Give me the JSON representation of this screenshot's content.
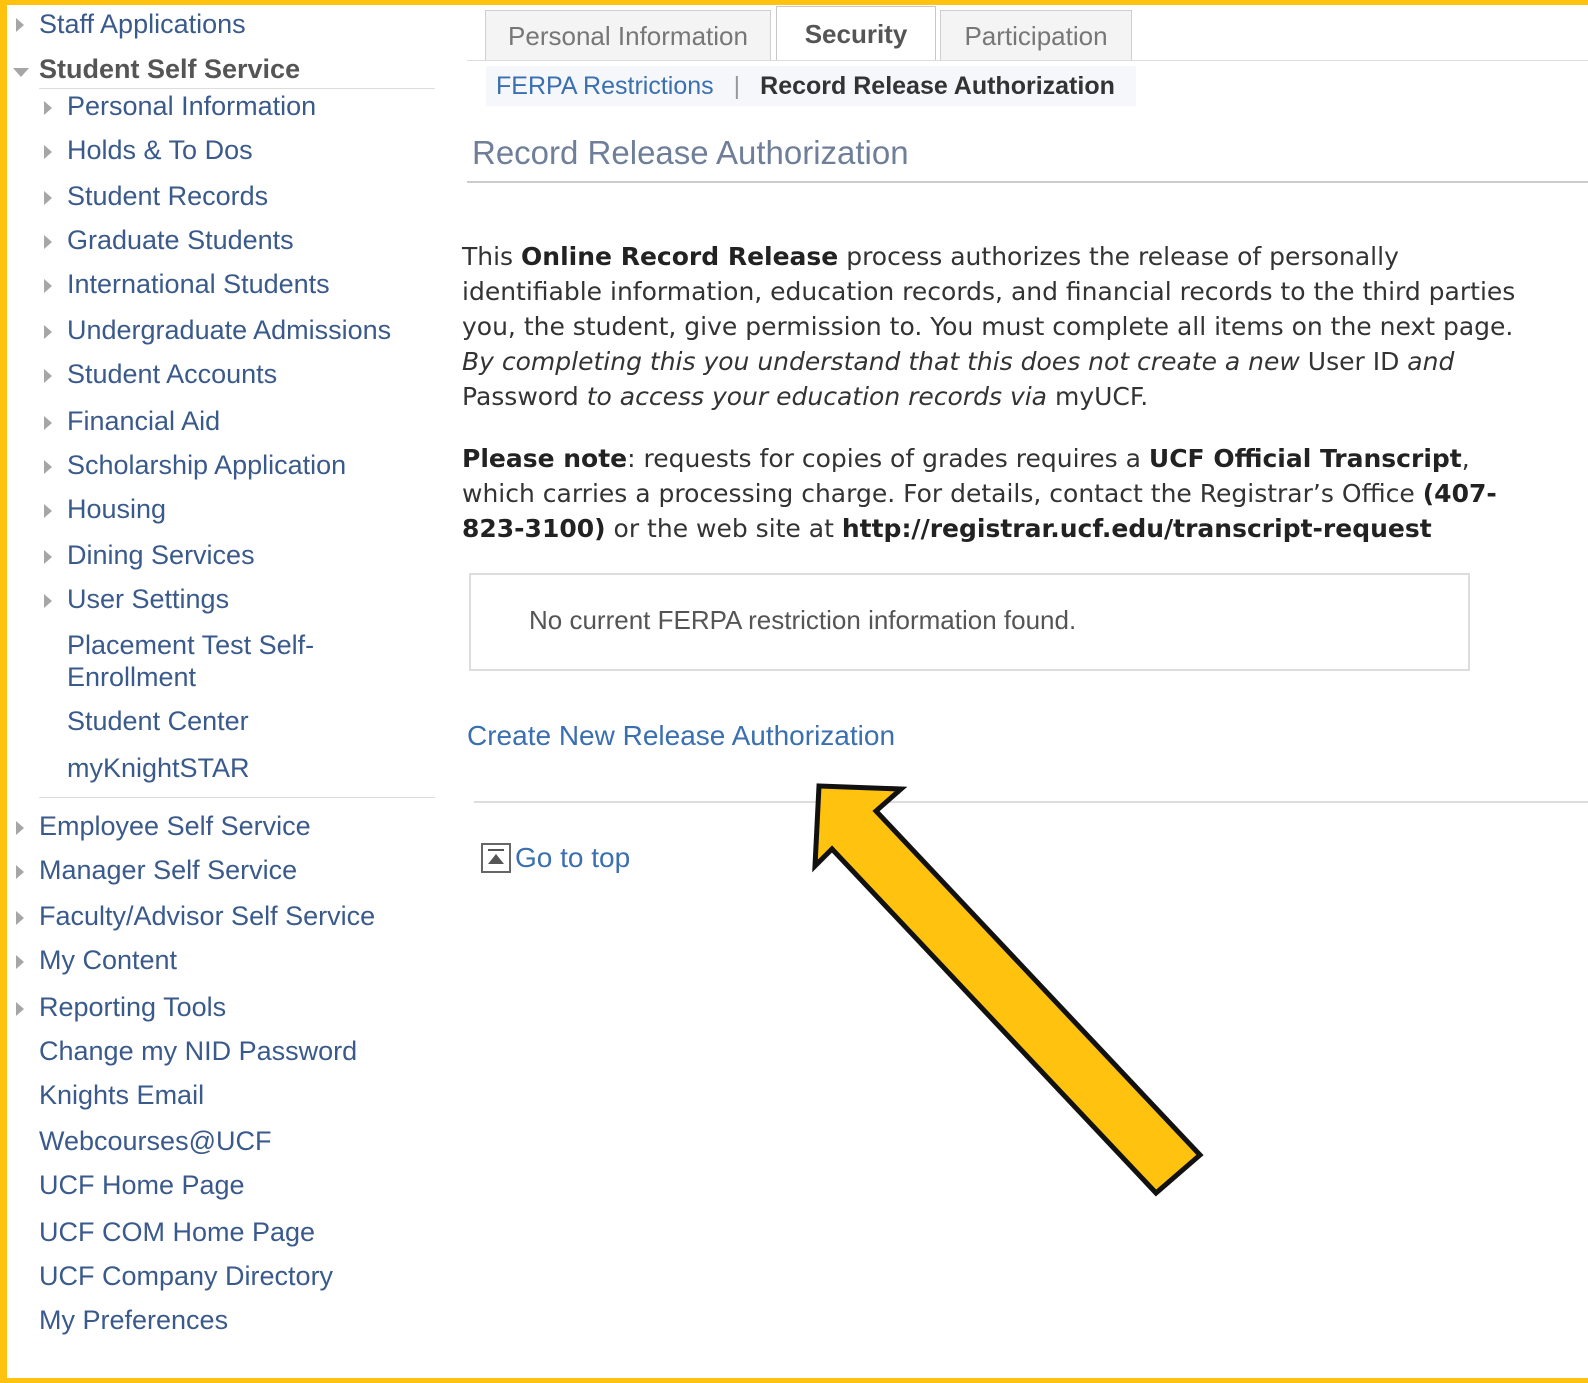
{
  "menu": {
    "staff_applications": "Staff Applications",
    "student_self_service": "Student Self Service",
    "sub_items": [
      "Personal Information",
      "Holds & To Dos",
      "Student Records",
      "Graduate Students",
      "International Students",
      "Undergraduate Admissions",
      "Student Accounts",
      "Financial Aid",
      "Scholarship Application",
      "Housing",
      "Dining Services",
      "User Settings"
    ],
    "placement_line1": "Placement Test Self-",
    "placement_line2": "Enrollment",
    "student_center": "Student Center",
    "myknightstar": "myKnightSTAR",
    "lower_items": [
      "Employee Self Service",
      "Manager Self Service",
      "Faculty/Advisor Self Service",
      "My Content",
      "Reporting Tools"
    ],
    "links": [
      "Change my NID Password",
      "Knights Email",
      "Webcourses@UCF",
      "UCF Home Page",
      "UCF COM Home Page",
      "UCF Company Directory",
      "My Preferences"
    ]
  },
  "tabs": {
    "personal": "Personal Information",
    "security": "Security",
    "participation": "Participation"
  },
  "subnav": {
    "ferpa": "FERPA Restrictions",
    "separator": "|",
    "current": "Record Release Authorization"
  },
  "page": {
    "title": "Record Release Authorization",
    "p1_a": "This ",
    "p1_b": "Online Record Release",
    "p1_c": " process authorizes the release of personally identifiable information, education records, and financial records to the third parties you, the student, give permission to. You must complete all items on the next page. ",
    "p1_d": "By completing this you understand that this does not create a new",
    "p1_e": " User ID ",
    "p1_f": "and",
    "p1_g": " Password ",
    "p1_h": "to access your education records via",
    "p1_i": " myUCF.",
    "p2_a": "Please note",
    "p2_b": ": requests for copies of grades requires a ",
    "p2_c": "UCF Official Transcript",
    "p2_d": ", which carries a processing charge. For details, contact the Registrar’s Office ",
    "p2_e": "(407-823-3100)",
    "p2_f": " or the web site at ",
    "p2_g": "http://registrar.ucf.edu/transcript-request",
    "info_message": "No current FERPA restriction information found.",
    "create_link": "Create New Release Authorization",
    "go_to_top": "Go to top"
  },
  "colors": {
    "frame": "#ffc20e",
    "arrow_fill": "#ffc20e",
    "link": "#3a6fb0",
    "menu_link": "#3a5a8c"
  }
}
